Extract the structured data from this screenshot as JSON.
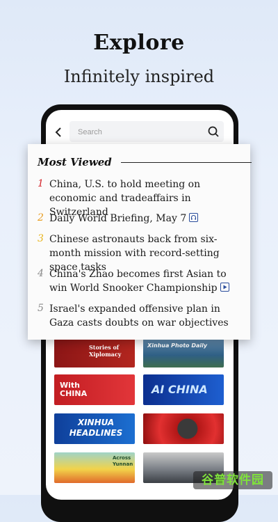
{
  "hero": {
    "title": "Explore",
    "subtitle": "Infinitely inspired"
  },
  "search": {
    "placeholder": "Search"
  },
  "most_viewed": {
    "title": "Most Viewed",
    "items": [
      {
        "rank": "1",
        "text": "China, U.S. to hold meeting on economic and tradeaffairs in Switzerland",
        "badge": ""
      },
      {
        "rank": "2",
        "text": "Daily World Briefing, May 7",
        "badge": "headphones-icon"
      },
      {
        "rank": "3",
        "text": "Chinese astronauts back from six-month mission with record-setting space tasks",
        "badge": ""
      },
      {
        "rank": "4",
        "text": "China's Zhao becomes first Asian to win World Snooker Championship",
        "badge": "play-icon"
      },
      {
        "rank": "5",
        "text": "Israel's expanded offensive plan in Gaza casts doubts on war objectives",
        "badge": ""
      }
    ],
    "rank_colors": [
      "#d4262c",
      "#e89a1c",
      "#e8b41c",
      "#8a8a8a",
      "#8a8a8a"
    ]
  },
  "tiles": [
    {
      "label": "Stories of Xiplomacy"
    },
    {
      "label": "Xinhua Photo Daily"
    },
    {
      "label": "With CHINA"
    },
    {
      "label": "AI CHINA"
    },
    {
      "label": "XINHUA HEADLINES"
    },
    {
      "label": ""
    },
    {
      "label": "Across Yunnan"
    },
    {
      "label": ""
    }
  ],
  "watermark": "谷普软件园",
  "colors": {
    "accent_red": "#d4262c",
    "link_blue": "#2a4d9c"
  }
}
